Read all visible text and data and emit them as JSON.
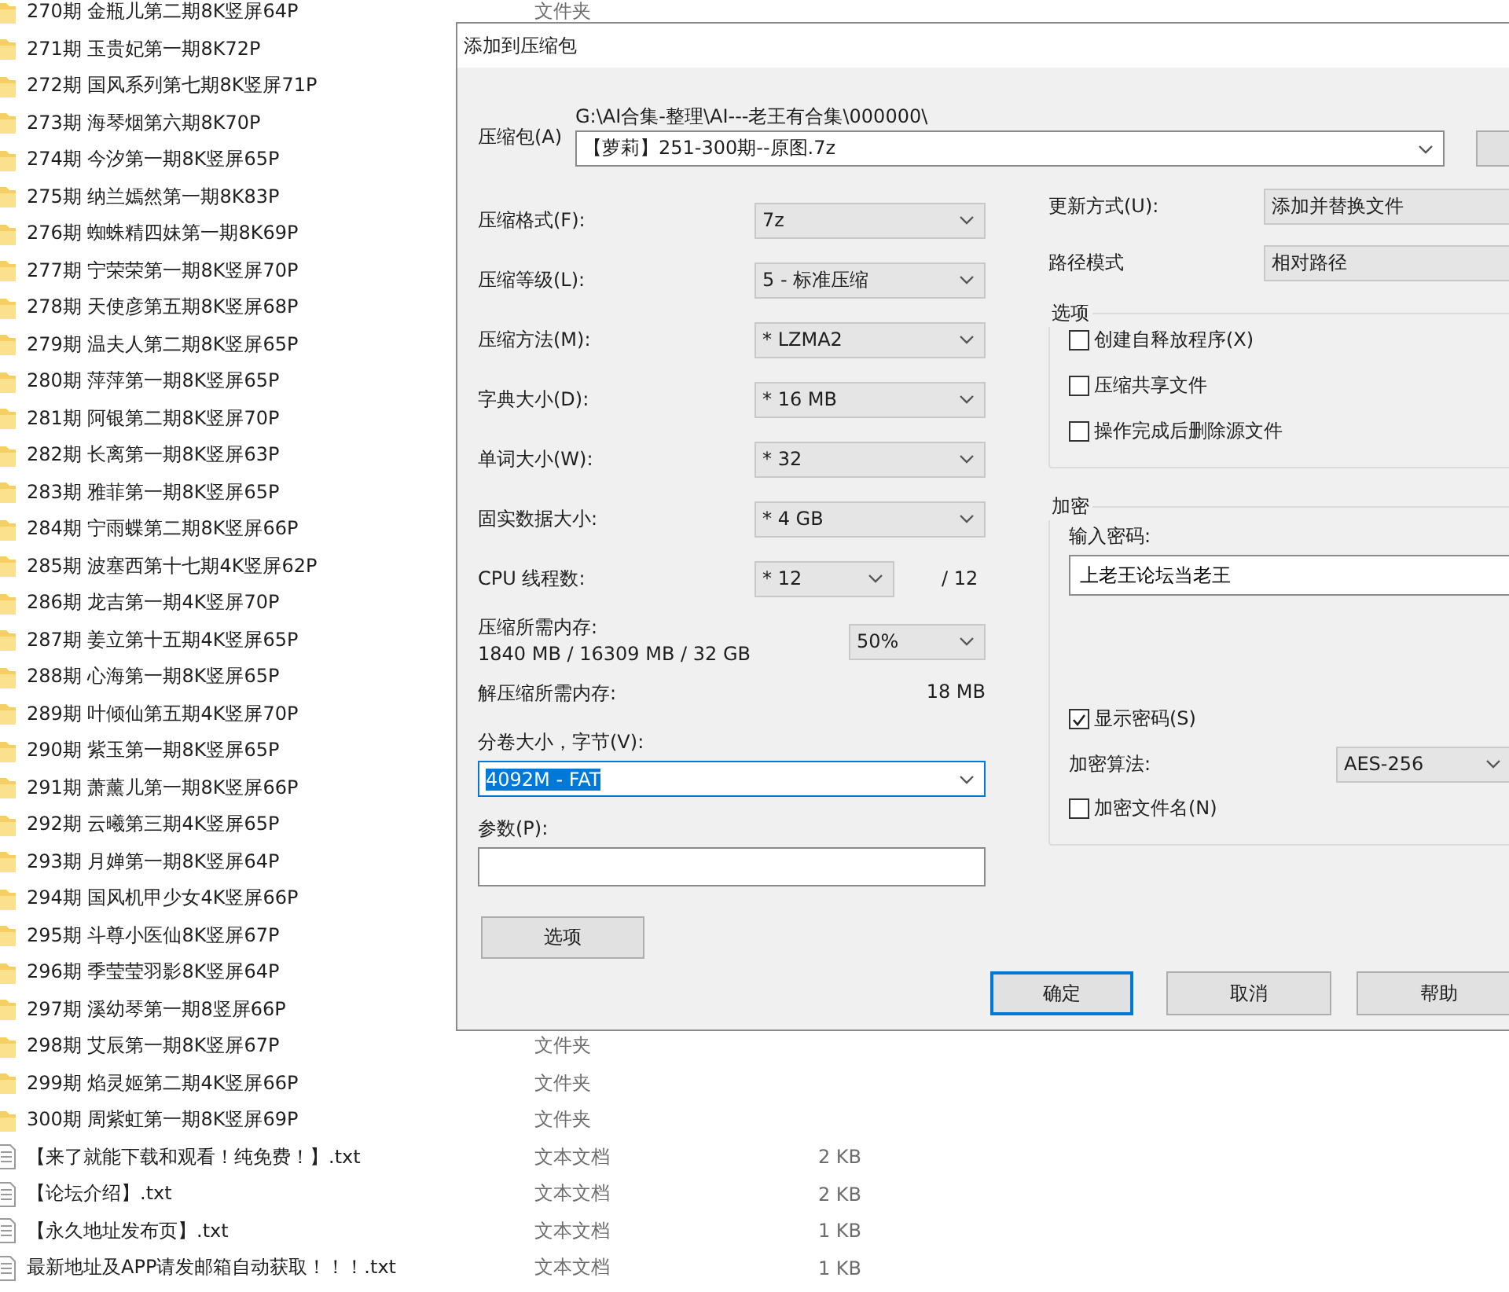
{
  "file_list": {
    "rows": [
      {
        "kind": "folder",
        "name": "270期 金瓶儿第二期8K竖屏64P",
        "type": "文件夹"
      },
      {
        "kind": "folder",
        "name": "271期 玉贵妃第一期8K72P"
      },
      {
        "kind": "folder",
        "name": "272期 国风系列第七期8K竖屏71P"
      },
      {
        "kind": "folder",
        "name": "273期 海琴烟第六期8K70P"
      },
      {
        "kind": "folder",
        "name": "274期 今汐第一期8K竖屏65P"
      },
      {
        "kind": "folder",
        "name": "275期 纳兰嫣然第一期8K83P"
      },
      {
        "kind": "folder",
        "name": "276期 蜘蛛精四妹第一期8K69P"
      },
      {
        "kind": "folder",
        "name": "277期 宁荣荣第一期8K竖屏70P"
      },
      {
        "kind": "folder",
        "name": "278期 天使彦第五期8K竖屏68P"
      },
      {
        "kind": "folder",
        "name": "279期 温夫人第二期8K竖屏65P"
      },
      {
        "kind": "folder",
        "name": "280期 萍萍第一期8K竖屏65P"
      },
      {
        "kind": "folder",
        "name": "281期 阿银第二期8K竖屏70P"
      },
      {
        "kind": "folder",
        "name": "282期 长离第一期8K竖屏63P"
      },
      {
        "kind": "folder",
        "name": "283期 雅菲第一期8K竖屏65P"
      },
      {
        "kind": "folder",
        "name": "284期 宁雨蝶第二期8K竖屏66P"
      },
      {
        "kind": "folder",
        "name": "285期 波塞西第十七期4K竖屏62P"
      },
      {
        "kind": "folder",
        "name": "286期 龙吉第一期4K竖屏70P"
      },
      {
        "kind": "folder",
        "name": "287期 姜立第十五期4K竖屏65P"
      },
      {
        "kind": "folder",
        "name": "288期 心海第一期8K竖屏65P"
      },
      {
        "kind": "folder",
        "name": "289期 叶倾仙第五期4K竖屏70P"
      },
      {
        "kind": "folder",
        "name": "290期 紫玉第一期8K竖屏65P"
      },
      {
        "kind": "folder",
        "name": "291期 萧薰儿第一期8K竖屏66P"
      },
      {
        "kind": "folder",
        "name": "292期 云曦第三期4K竖屏65P"
      },
      {
        "kind": "folder",
        "name": "293期 月婵第一期8K竖屏64P"
      },
      {
        "kind": "folder",
        "name": "294期 国风机甲少女4K竖屏66P"
      },
      {
        "kind": "folder",
        "name": "295期 斗尊小医仙8K竖屏67P"
      },
      {
        "kind": "folder",
        "name": "296期 季莹莹羽影8K竖屏64P"
      },
      {
        "kind": "folder",
        "name": "297期 溪幼琴第一期8竖屏66P"
      },
      {
        "kind": "folder",
        "name": "298期 艾辰第一期8K竖屏67P",
        "type": "文件夹"
      },
      {
        "kind": "folder",
        "name": "299期 焰灵姬第二期4K竖屏66P",
        "type": "文件夹"
      },
      {
        "kind": "folder",
        "name": "300期 周紫虹第一期8K竖屏69P",
        "type": "文件夹"
      },
      {
        "kind": "text",
        "name": "【来了就能下载和观看！纯免费！】.txt",
        "type": "文本文档",
        "size": "2 KB"
      },
      {
        "kind": "text",
        "name": "【论坛介绍】.txt",
        "type": "文本文档",
        "size": "2 KB"
      },
      {
        "kind": "text",
        "name": "【永久地址发布页】.txt",
        "type": "文本文档",
        "size": "1 KB"
      },
      {
        "kind": "text",
        "name": "最新地址及APP请发邮箱自动获取！！！.txt",
        "type": "文本文档",
        "size": "1 KB"
      }
    ]
  },
  "dialog": {
    "title": "添加到压缩包",
    "archive": {
      "label": "压缩包(A)",
      "path": "G:\\AI合集-整理\\AI---老王有合集\\000000\\",
      "value": "【萝莉】251-300期--原图.7z"
    },
    "left_fields": [
      {
        "label": "压缩格式(F):",
        "value": "7z"
      },
      {
        "label": "压缩等级(L):",
        "value": "5 - 标准压缩"
      },
      {
        "label": "压缩方法(M):",
        "value": "* LZMA2"
      },
      {
        "label": "字典大小(D):",
        "value": "* 16 MB"
      },
      {
        "label": "单词大小(W):",
        "value": "* 32"
      },
      {
        "label": "固实数据大小:",
        "value": "* 4 GB"
      }
    ],
    "threads": {
      "label": "CPU 线程数:",
      "value": "* 12",
      "max": "/ 12"
    },
    "compress_memory": {
      "label": "压缩所需内存:",
      "detail": "1840 MB / 16309 MB / 32 GB",
      "value": "50%"
    },
    "decompress_memory": {
      "label": "解压缩所需内存:",
      "value": "18 MB"
    },
    "volume": {
      "label": "分卷大小，字节(V):",
      "value": "4092M - FAT",
      "focused": true
    },
    "parameters": {
      "label": "参数(P):"
    },
    "options_button": "选项",
    "right_fields": [
      {
        "label": "更新方式(U):",
        "value": "添加并替换文件"
      },
      {
        "label": "路径模式",
        "value": "相对路径"
      }
    ],
    "options_group": {
      "title": "选项",
      "checkboxes": [
        {
          "label": "创建自释放程序(X)",
          "checked": false
        },
        {
          "label": "压缩共享文件",
          "checked": false
        },
        {
          "label": "操作完成后删除源文件",
          "checked": false
        }
      ]
    },
    "encryption": {
      "title": "加密",
      "password_label": "输入密码:",
      "password": "上老王论坛当老王",
      "show_password": {
        "label": "显示密码(S)",
        "checked": true
      },
      "method_label": "加密算法:",
      "method": "AES-256",
      "encrypt_names": {
        "label": "加密文件名(N)",
        "checked": false
      }
    },
    "buttons": [
      {
        "label": "确定",
        "default": true
      },
      {
        "label": "取消",
        "default": false
      },
      {
        "label": "帮助",
        "default": false
      }
    ]
  }
}
